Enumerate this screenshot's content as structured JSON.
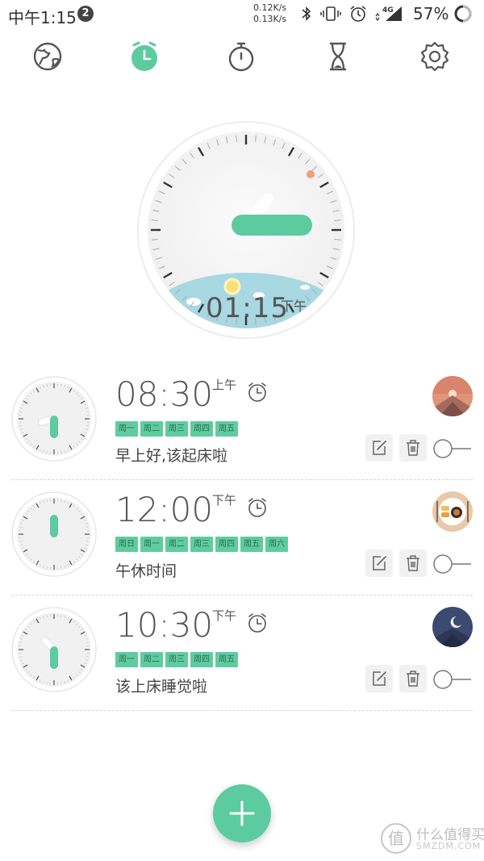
{
  "status_bar": {
    "time": "中午1:15",
    "notification_count": "2",
    "net_up": "0.12K/s",
    "net_down": "0.13K/s",
    "network": "4G",
    "battery": "57%"
  },
  "tabs": [
    {
      "icon": "globe-icon",
      "active": false
    },
    {
      "icon": "alarm-clock-icon",
      "active": true
    },
    {
      "icon": "stopwatch-icon",
      "active": false
    },
    {
      "icon": "hourglass-icon",
      "active": false
    },
    {
      "icon": "settings-gear-icon",
      "active": false
    }
  ],
  "current_clock": {
    "time": "01:15",
    "ampm": "下午"
  },
  "alarms": [
    {
      "time": "08:30",
      "ampm": "上午",
      "days": [
        "周一",
        "周二",
        "周三",
        "周四",
        "周五"
      ],
      "label": "早上好,该起床啦",
      "avatar": "sunrise-mountain-icon",
      "enabled": false
    },
    {
      "time": "12:00",
      "ampm": "下午",
      "days": [
        "周日",
        "周一",
        "周二",
        "周三",
        "周四",
        "周五",
        "周六"
      ],
      "label": "午休时间",
      "avatar": "lunch-plate-icon",
      "enabled": false
    },
    {
      "time": "10:30",
      "ampm": "下午",
      "days": [
        "周一",
        "周二",
        "周三",
        "周四",
        "周五"
      ],
      "label": "该上床睡觉啦",
      "avatar": "night-moon-icon",
      "enabled": false
    }
  ],
  "watermark": {
    "logo": "值",
    "cn": "什么值得买",
    "en": "SMZDM.COM"
  },
  "colors": {
    "accent": "#5ccba0",
    "chip_text": "#2b6b51",
    "sky": "#a8d8e2",
    "sun": "#f5e07a"
  }
}
